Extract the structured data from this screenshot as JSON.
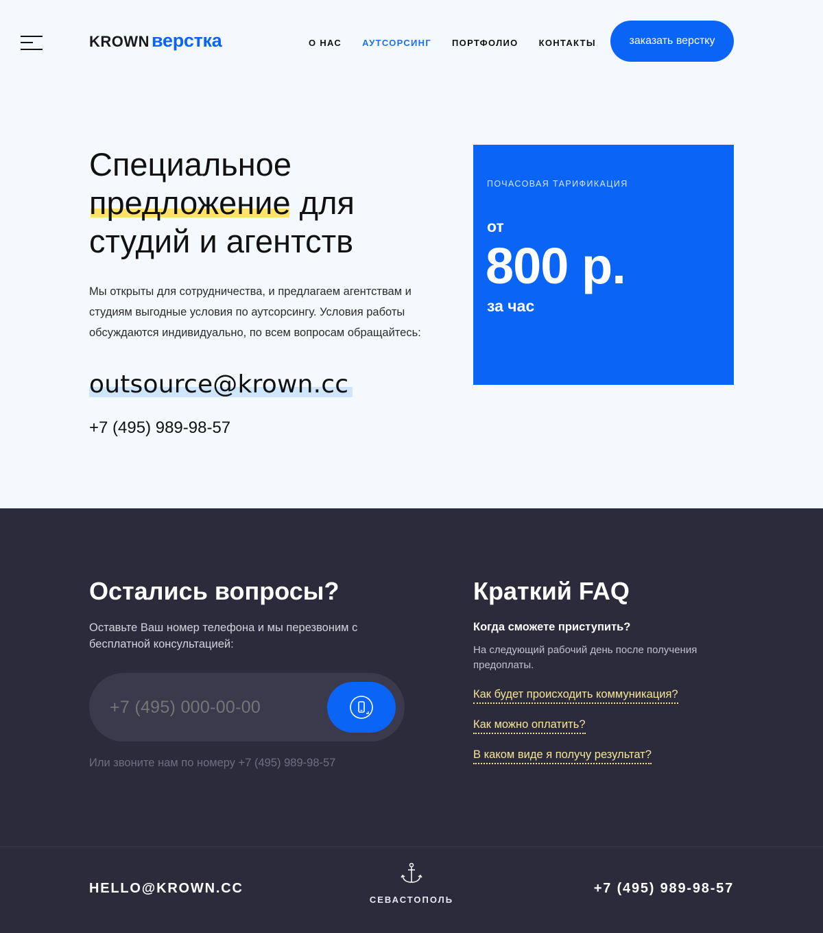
{
  "header": {
    "logo": {
      "part1": "KROWN",
      "part2": "верстка"
    },
    "nav": [
      {
        "label": "О НАС",
        "active": false
      },
      {
        "label": "АУТСОРСИНГ",
        "active": true
      },
      {
        "label": "ПОРТФОЛИО",
        "active": false
      },
      {
        "label": "КОНТАКТЫ",
        "active": false
      }
    ],
    "cta": "заказать верстку"
  },
  "hero": {
    "title_line1": "Специальное",
    "title_highlight": "предложение",
    "title_rest1": " для",
    "title_line3": "студий и агентств",
    "text": "Мы открыты для сотрудничества, и предлагаем агентствам и студиям выгодные условия по аутсорсингу. Условия работы обсуждаются индивидуально, по всем вопросам обращайтесь:",
    "email": "outsource@krown.cc",
    "phone": "+7 (495) 989-98-57"
  },
  "price": {
    "label": "ПОЧАСОВАЯ ТАРИФИКАЦИЯ",
    "from": "от",
    "amount": "800 р.",
    "per": "за час"
  },
  "questions": {
    "title": "Остались вопросы?",
    "text": "Оставьте Ваш номер телефона и мы перезвоним с бесплатной консультацией:",
    "phone_placeholder": "+7 (495) 000-00-00",
    "note": "Или звоните нам по номеру +7 (495) 989-98-57"
  },
  "faq": {
    "title": "Краткий FAQ",
    "q1": "Когда сможете приступить?",
    "a1": "На следующий рабочий день после получения предоплаты.",
    "links": [
      "Как будет происходить коммуникация?",
      "Как можно оплатить?",
      "В каком виде я получу результат?"
    ]
  },
  "footer": {
    "email": "HELLO@KROWN.CC",
    "city": "СЕВАСТОПОЛЬ",
    "phone": "+7 (495) 989-98-57"
  },
  "colors": {
    "accent": "#0a64f5",
    "dark_bg": "#2c2b3c",
    "highlight_yellow": "#fde468",
    "faq_link": "#f5e59a"
  },
  "icons": {
    "menu": "hamburger-icon",
    "call": "phone-call-icon",
    "city": "anchor-icon"
  }
}
